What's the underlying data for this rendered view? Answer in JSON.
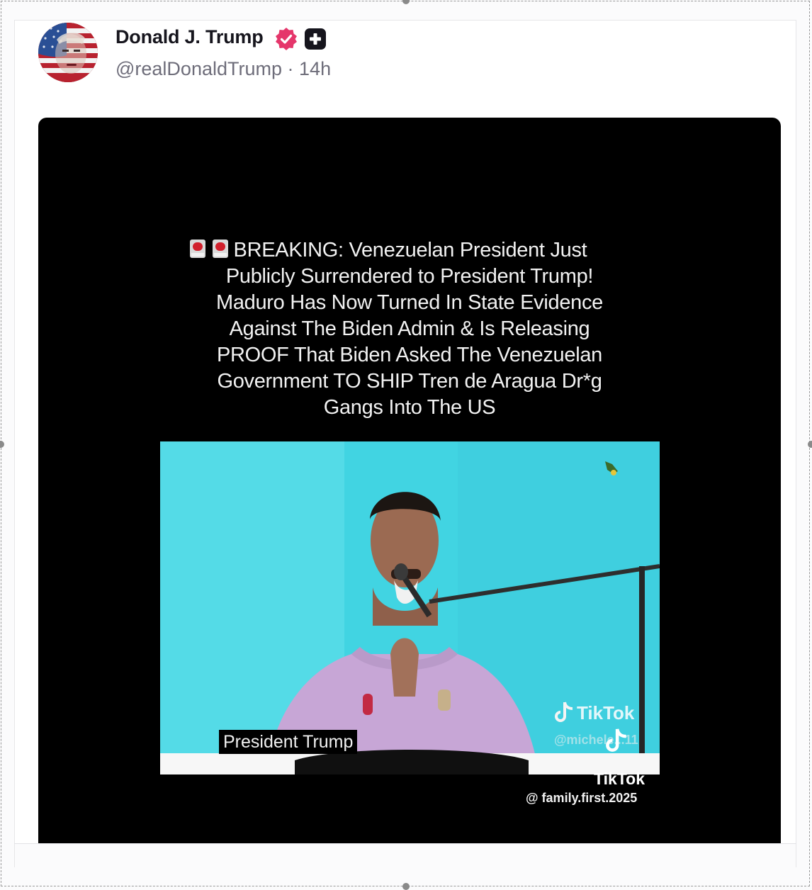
{
  "post": {
    "author_name": "Donald J. Trump",
    "handle": "@realDonaldTrump",
    "separator": "·",
    "time_ago": "14h"
  },
  "badges": {
    "verified_icon": "verified-badge-icon",
    "verified_color": "#e5366b",
    "plus_icon": "plus-badge-icon"
  },
  "media": {
    "headline": "BREAKING: Venezuelan President Just Publicly Surrendered to President Trump! Maduro Has Now Turned In State Evidence Against The Biden Admin & Is Releasing PROOF That Biden Asked The Venezuelan Government TO SHIP Tren de Aragua Dr*g Gangs Into The US",
    "headline_lines": [
      "BREAKING: Venezuelan President Just",
      "Publicly Surrendered to President Trump!",
      "Maduro Has Now Turned In State Evidence",
      "Against The Biden Admin & Is Releasing",
      "PROOF That Biden Asked The Venezuelan",
      "Government TO SHIP Tren de Aragua Dr*g",
      "Gangs Into The US"
    ],
    "video_caption": "President Trump",
    "watermark_1": "TikTok",
    "watermark_1_handle": "@michele...11",
    "watermark_2": "TikTok",
    "watermark_2_handle": "@ family.first.2025"
  }
}
